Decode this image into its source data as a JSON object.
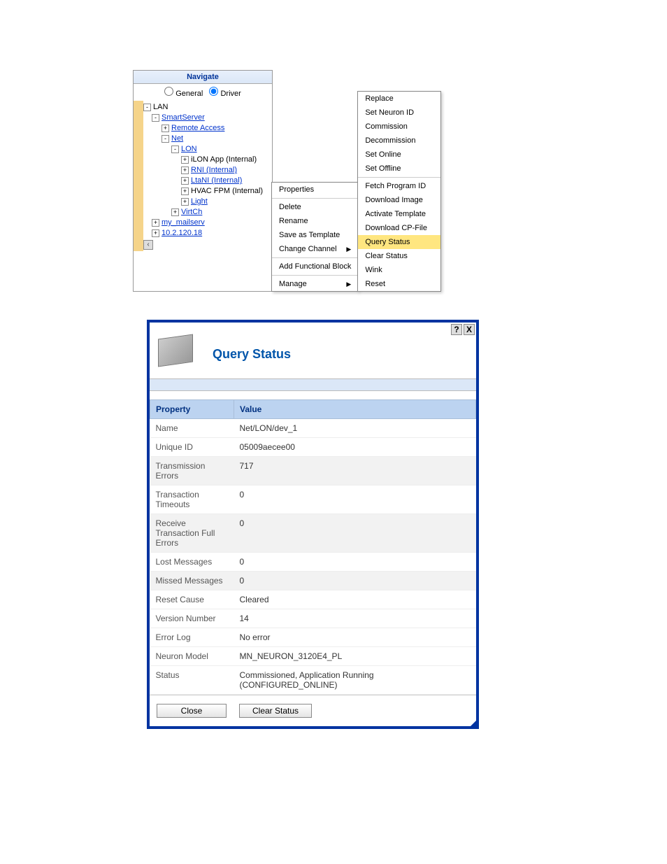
{
  "nav": {
    "header": "Navigate",
    "radio_general": "General",
    "radio_driver": "Driver",
    "tree": {
      "lan": "LAN",
      "smartserver": "SmartServer",
      "remote_access": "Remote Access",
      "net": "Net",
      "lon": "LON",
      "ilon_app": "iLON App (Internal)",
      "rni": "RNI (Internal)",
      "ltani": "LtaNI (Internal)",
      "hvac_fpm": "HVAC FPM (Internal)",
      "light": "Light",
      "virtch": "VirtCh",
      "mailserv": "my_mailserv",
      "ip": "10.2.120.18"
    }
  },
  "ctx1": {
    "properties": "Properties",
    "delete": "Delete",
    "rename": "Rename",
    "save_template": "Save as Template",
    "change_channel": "Change Channel",
    "add_fb": "Add Functional Block",
    "manage": "Manage"
  },
  "ctx2": {
    "replace": "Replace",
    "set_neuron": "Set Neuron ID",
    "commission": "Commission",
    "decommission": "Decommission",
    "set_online": "Set Online",
    "set_offline": "Set Offline",
    "fetch_pid": "Fetch Program ID",
    "download_image": "Download Image",
    "activate_template": "Activate Template",
    "download_cp": "Download CP-File",
    "query_status": "Query Status",
    "clear_status": "Clear Status",
    "wink": "Wink",
    "reset": "Reset"
  },
  "dialog": {
    "title": "Query Status",
    "help": "?",
    "close": "X",
    "col_property": "Property",
    "col_value": "Value",
    "rows": [
      {
        "p": "Name",
        "v": "Net/LON/dev_1"
      },
      {
        "p": "Unique ID",
        "v": "05009aecee00"
      },
      {
        "p": "Transmission Errors",
        "v": "717"
      },
      {
        "p": "Transaction Timeouts",
        "v": "0"
      },
      {
        "p": "Receive Transaction Full Errors",
        "v": "0"
      },
      {
        "p": "Lost Messages",
        "v": "0"
      },
      {
        "p": "Missed Messages",
        "v": "0"
      },
      {
        "p": "Reset Cause",
        "v": "Cleared"
      },
      {
        "p": "Version Number",
        "v": "14"
      },
      {
        "p": "Error Log",
        "v": "No error"
      },
      {
        "p": "Neuron Model",
        "v": "MN_NEURON_3120E4_PL"
      },
      {
        "p": "Status",
        "v": "Commissioned, Application Running (CONFIGURED_ONLINE)"
      }
    ],
    "btn_close": "Close",
    "btn_clear": "Clear Status"
  }
}
